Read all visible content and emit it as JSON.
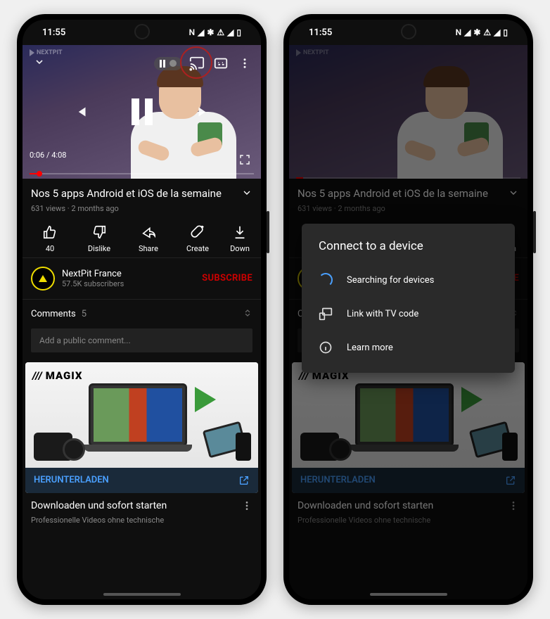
{
  "statusbar": {
    "time": "11:55"
  },
  "watermark": "NEXTPIT",
  "player": {
    "time_current": "0:06",
    "time_total": "4:08",
    "progress_pct": 3
  },
  "video": {
    "title": "Nos 5 apps Android et iOS de la semaine",
    "views": "631 views",
    "age": "2 months ago"
  },
  "actions": {
    "like_count": "40",
    "dislike": "Dislike",
    "share": "Share",
    "create": "Create",
    "download": "Down"
  },
  "channel": {
    "name": "NextPit France",
    "subs": "57.5K subscribers",
    "subscribe": "SUBSCRIBE"
  },
  "comments": {
    "label": "Comments",
    "count": "5",
    "placeholder": "Add a public comment..."
  },
  "ad": {
    "brand": "MAGIX",
    "cta": "HERUNTERLADEN",
    "title": "Downloaden und sofort starten",
    "subtitle": "Professionelle Videos ohne technische"
  },
  "dialog": {
    "title": "Connect to a device",
    "searching": "Searching for devices",
    "link_tv": "Link with TV code",
    "learn": "Learn more"
  }
}
